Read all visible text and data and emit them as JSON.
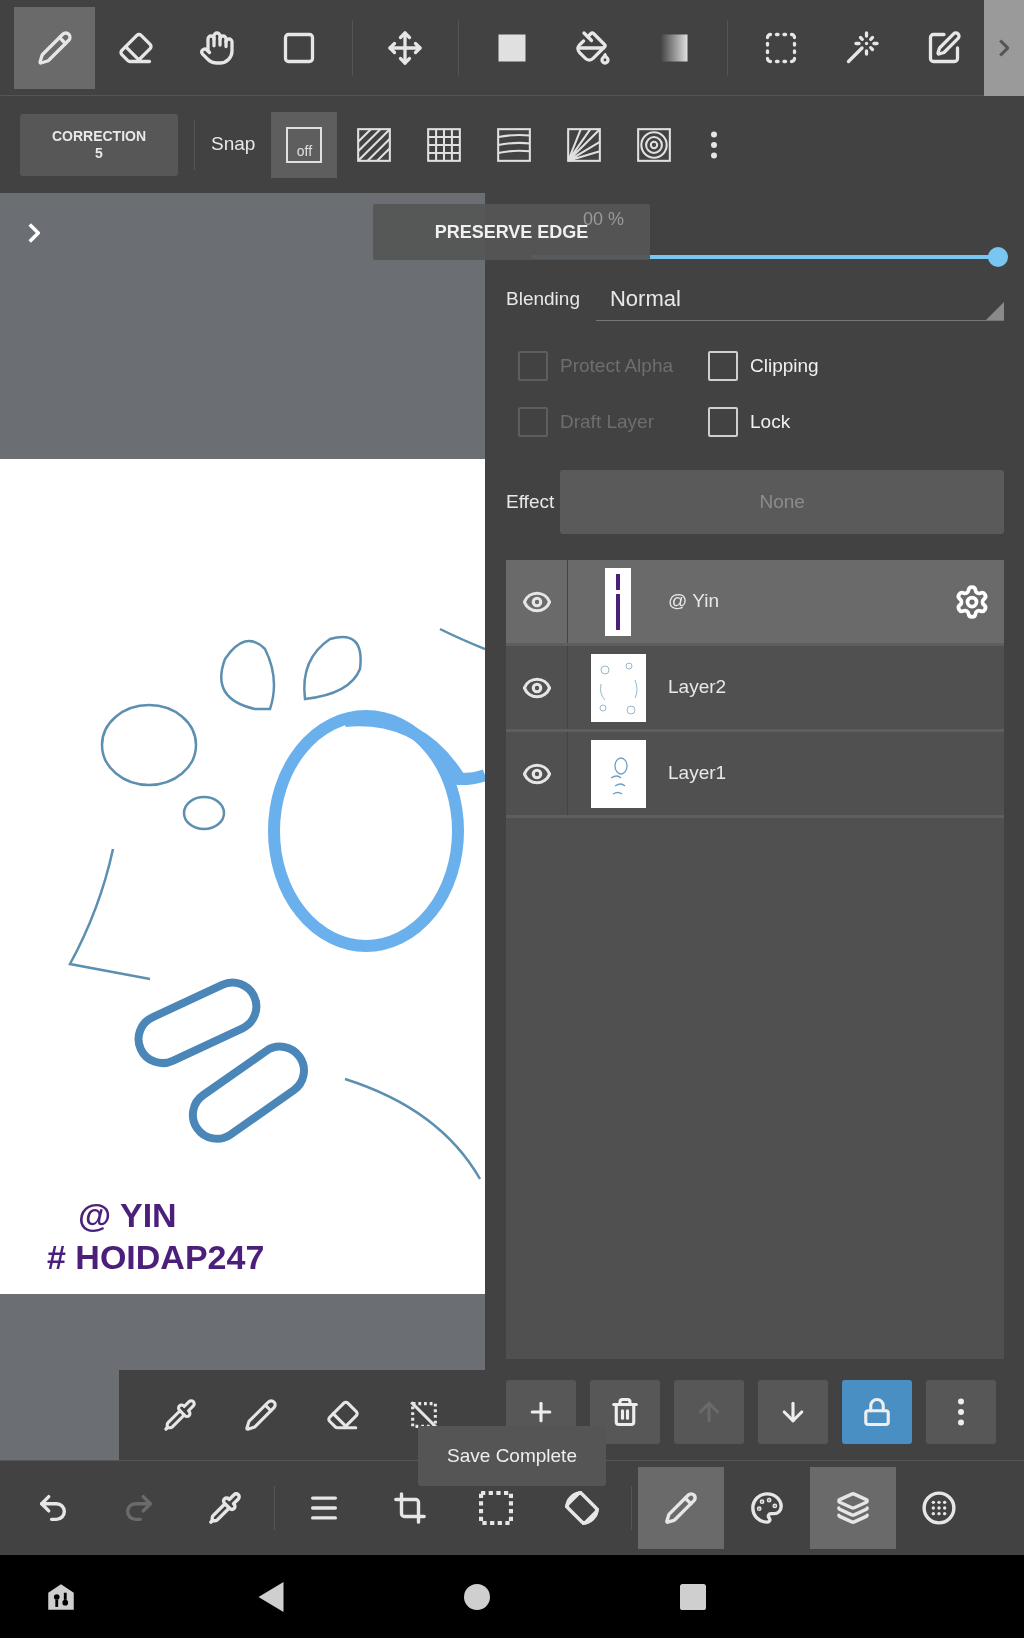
{
  "tool_groups": [
    [
      {
        "kind": "pen",
        "selected": true
      },
      {
        "kind": "eraser",
        "selected": false
      },
      {
        "kind": "hand",
        "selected": false
      },
      {
        "kind": "shape",
        "selected": false
      }
    ],
    [
      {
        "kind": "move",
        "selected": false
      }
    ],
    [
      {
        "kind": "fill",
        "selected": false
      },
      {
        "kind": "bucket",
        "selected": false
      },
      {
        "kind": "gradient",
        "selected": false
      }
    ],
    [
      {
        "kind": "select",
        "selected": false
      },
      {
        "kind": "wand",
        "selected": false
      },
      {
        "kind": "selpen",
        "selected": false
      }
    ]
  ],
  "option_bar": {
    "correction_label": "CORRECTION",
    "correction_value": "5",
    "snap_label": "Snap",
    "snap_modes": [
      {
        "kind": "off",
        "label": "off",
        "selected": true
      },
      {
        "kind": "parallel",
        "selected": false
      },
      {
        "kind": "grid",
        "selected": false
      },
      {
        "kind": "curve",
        "selected": false
      },
      {
        "kind": "radial",
        "selected": false
      },
      {
        "kind": "circle",
        "selected": false
      }
    ]
  },
  "canvas": {
    "drawing_text": [
      "@ YIN",
      "# HOIDAP247"
    ]
  },
  "tooltip": "PRESERVE EDGE",
  "layer_properties": {
    "opacity_reading": "00 %",
    "opacity": {
      "level": 1
    },
    "blending_label": "Blending",
    "blending_value": "Normal",
    "options": [
      {
        "label": "Protect Alpha",
        "checked": false,
        "disabled": true
      },
      {
        "label": "Clipping",
        "checked": false,
        "disabled": false
      },
      {
        "label": "Draft Layer",
        "checked": false,
        "disabled": true
      },
      {
        "label": "Lock",
        "checked": false,
        "disabled": false
      }
    ],
    "effect_label": "Effect",
    "effect_value": "None"
  },
  "layers": [
    {
      "name": "@ Yin",
      "visible": true,
      "selected": true,
      "kind": "text"
    },
    {
      "name": "Layer2",
      "visible": true,
      "selected": false,
      "kind": "sketch"
    },
    {
      "name": "Layer1",
      "visible": true,
      "selected": false,
      "kind": "ovals"
    }
  ],
  "layer_actions": [
    {
      "kind": "add",
      "disabled": false,
      "selected": false
    },
    {
      "kind": "delete",
      "disabled": false,
      "selected": false
    },
    {
      "kind": "up",
      "disabled": true,
      "selected": false
    },
    {
      "kind": "down",
      "disabled": false,
      "selected": false
    },
    {
      "kind": "lock",
      "disabled": false,
      "selected": true
    },
    {
      "kind": "more",
      "disabled": false,
      "selected": false
    }
  ],
  "brush_bar": [
    {
      "kind": "eyedropper"
    },
    {
      "kind": "pen"
    },
    {
      "kind": "eraser"
    },
    {
      "kind": "deselect"
    }
  ],
  "bottom_bar": [
    {
      "kind": "undo",
      "disabled": false,
      "selected": false
    },
    {
      "kind": "redo",
      "disabled": true,
      "selected": false
    },
    {
      "kind": "eyedropper",
      "disabled": false,
      "selected": false
    },
    {
      "kind": "menu",
      "disabled": false,
      "selected": false
    },
    {
      "kind": "transform",
      "disabled": false,
      "selected": false
    },
    {
      "kind": "select",
      "disabled": false,
      "selected": false
    },
    {
      "kind": "rotate",
      "disabled": false,
      "selected": false
    },
    {
      "kind": "pen",
      "disabled": false,
      "selected": true
    },
    {
      "kind": "palette",
      "disabled": false,
      "selected": false
    },
    {
      "kind": "layers",
      "disabled": false,
      "selected": true
    },
    {
      "kind": "grid",
      "disabled": false,
      "selected": false
    }
  ],
  "toast": "Save Complete",
  "nav_bar": [
    {
      "kind": "assist"
    },
    {
      "kind": "back"
    },
    {
      "kind": "home"
    },
    {
      "kind": "recents"
    }
  ]
}
